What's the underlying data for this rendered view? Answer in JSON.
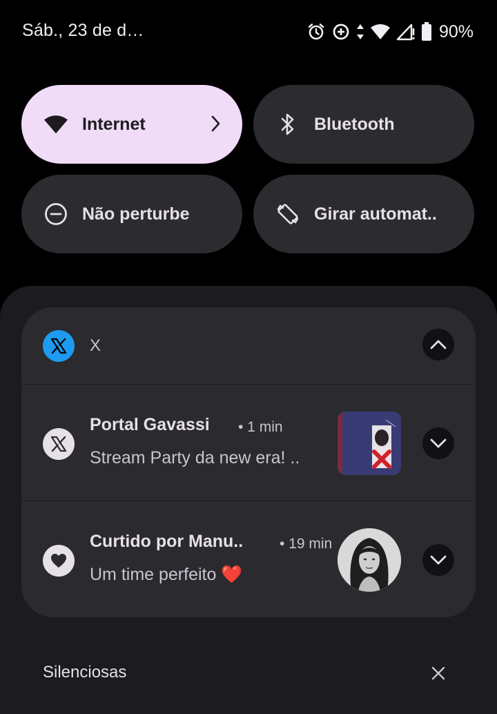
{
  "status_bar": {
    "date": "Sáb., 23 de d…",
    "battery_percent": "90%",
    "icons": [
      "alarm-icon",
      "data-saver-icon",
      "data-arrows-icon",
      "wifi-icon",
      "no-signal-icon",
      "battery-icon"
    ]
  },
  "quick_settings": {
    "tiles": [
      {
        "label": "Internet",
        "icon": "wifi-icon",
        "active": true,
        "has_chevron": true
      },
      {
        "label": "Bluetooth",
        "icon": "bluetooth-icon",
        "active": false
      },
      {
        "label": "Não perturbe",
        "icon": "do-not-disturb-icon",
        "active": false
      },
      {
        "label": "Girar automat..",
        "icon": "auto-rotate-icon",
        "active": false
      }
    ]
  },
  "notification_group": {
    "app_name": "X",
    "app_icon": "x-logo-icon",
    "expanded": true,
    "notifications": [
      {
        "title": "Portal Gavassi",
        "time": "• 1 min",
        "body": "Stream Party da new era! ..",
        "icon": "x-logo-icon",
        "thumbnail": "album-cover-thumbnail"
      },
      {
        "title": "Curtido por Manu..",
        "time": "• 19 min",
        "body": "Um time perfeito ❤️",
        "icon": "heart-icon",
        "thumbnail": "profile-photo-thumbnail"
      }
    ]
  },
  "silent_section": {
    "title": "Silenciosas",
    "close_icon": "close-icon"
  },
  "colors": {
    "background": "#000000",
    "shade": "#1c1b1f",
    "card": "#2b2a2e",
    "tile": "#2c2b2f",
    "active_tile": "#f0dcf7",
    "x_brand": "#1d9bf0",
    "heart": "#e53935"
  }
}
